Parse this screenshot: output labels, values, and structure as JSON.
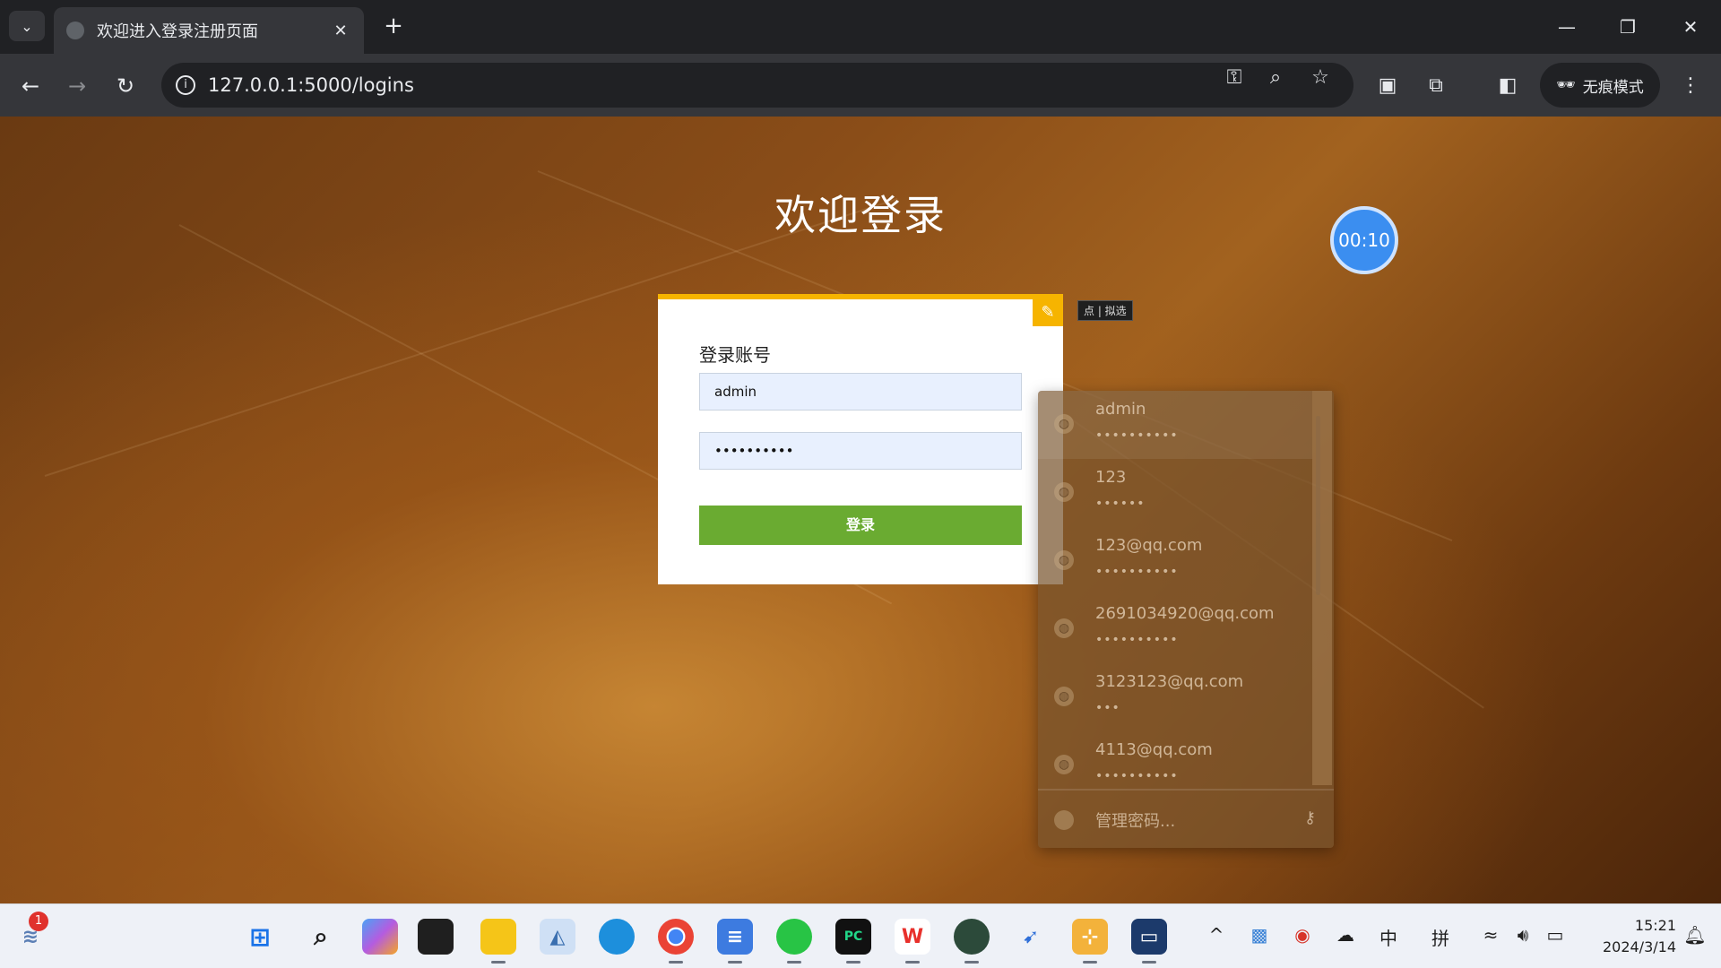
{
  "browser": {
    "tab_title": "欢迎进入登录注册页面",
    "tab_close": "✕",
    "new_tab": "+",
    "url": "127.0.0.1:5000/logins",
    "incognito_label": "无痕模式"
  },
  "page": {
    "heading": "欢迎登录",
    "timer": "00:10",
    "edit_tooltip": "点 | 拟选"
  },
  "login_card": {
    "heading": "登录账号",
    "username_value": "admin",
    "password_value": "••••••••••",
    "submit_label": "登录"
  },
  "password_dropdown": {
    "entries": [
      {
        "user": "admin",
        "dots": "••••••••••"
      },
      {
        "user": "123",
        "dots": "••••••"
      },
      {
        "user": "123@qq.com",
        "dots": "••••••••••"
      },
      {
        "user": "2691034920@qq.com",
        "dots": "••••••••••"
      },
      {
        "user": "3123123@qq.com",
        "dots": "•••"
      },
      {
        "user": "4113@qq.com",
        "dots": "••••••••••"
      }
    ],
    "manage_label": "管理密码..."
  },
  "taskbar": {
    "notification_count": "1",
    "ime_lang": "中",
    "ime_mode": "拼",
    "time": "15:21",
    "date": "2024/3/14"
  },
  "colors": {
    "card_accent": "#f6b400",
    "login_button": "#6aab31",
    "timer": "#3b8ef0"
  }
}
